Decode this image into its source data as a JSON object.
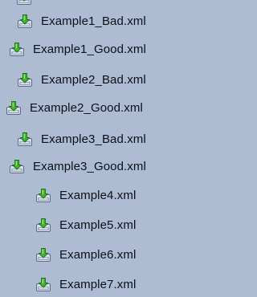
{
  "file_list": {
    "items": [
      {
        "label": "Example1_Bad.xml",
        "icon": "xml-document-download-icon"
      },
      {
        "label": "Example1_Good.xml",
        "icon": "xml-document-download-icon"
      },
      {
        "label": "Example2_Bad.xml",
        "icon": "xml-document-download-icon"
      },
      {
        "label": "Example2_Good.xml",
        "icon": "xml-document-download-icon"
      },
      {
        "label": "Example3_Bad.xml",
        "icon": "xml-document-download-icon"
      },
      {
        "label": "Example3_Good.xml",
        "icon": "xml-document-download-icon"
      },
      {
        "label": "Example4.xml",
        "icon": "xml-document-download-icon"
      },
      {
        "label": "Example5.xml",
        "icon": "xml-document-download-icon"
      },
      {
        "label": "Example6.xml",
        "icon": "xml-document-download-icon"
      },
      {
        "label": "Example7.xml",
        "icon": "xml-document-download-icon"
      }
    ]
  },
  "colors": {
    "background": "#aebcd3",
    "text": "#0b0f18",
    "icon_arrow": "#3fb52a",
    "icon_tray": "#8f9bb3"
  }
}
